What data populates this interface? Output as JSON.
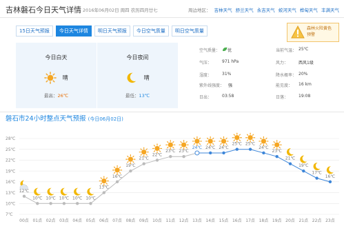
{
  "header": {
    "title": "吉林磐石今日天气详情",
    "date": "2016年06月02日   周四   农历四月廿七",
    "nearby_label": "周边地区：",
    "nearby": [
      "吉林天气",
      "舒兰天气",
      "永吉天气",
      "蛟河天气",
      "桦甸天气",
      "丰满天气"
    ]
  },
  "tabs": [
    "15日天气预报",
    "今日天气详情",
    "明日天气预报",
    "今日空气质量",
    "明日空气质量"
  ],
  "active_tab": 1,
  "alert": {
    "line1": "森林火险黄色",
    "line2": "预警"
  },
  "day": {
    "title": "今日白天",
    "weather": "晴",
    "temp_label": "最高：",
    "temp": "26℃",
    "icon": "sun-icon"
  },
  "night": {
    "title": "今日夜间",
    "weather": "晴",
    "temp_label": "最低：",
    "temp": "13℃",
    "icon": "moon-icon"
  },
  "details": [
    {
      "k1": "空气质量：",
      "v1": "优",
      "k2": "当前气温：",
      "v2": "25℃"
    },
    {
      "k1": "气压：",
      "v1": "971 hPa",
      "k2": "风力：",
      "v2": "西风1级"
    },
    {
      "k1": "湿度：",
      "v1": "31%",
      "k2": "降水概率：",
      "v2": "20%"
    },
    {
      "k1": "紫外线强度：",
      "v1": "强",
      "k2": "能见度：",
      "v2": "16 km"
    },
    {
      "k1": "日出：",
      "v1": "03:58",
      "k2": "日落：",
      "v2": "19:08"
    }
  ],
  "chart_title": "磐石市24小时整点天气预报",
  "chart_subtitle": "(今日06月02日)",
  "chart_data": {
    "type": "line",
    "x": [
      "00点",
      "01点",
      "02点",
      "03点",
      "04点",
      "05点",
      "06点",
      "07点",
      "08点",
      "09点",
      "10点",
      "11点",
      "12点",
      "13点",
      "14点",
      "15点",
      "16点",
      "17点",
      "18点",
      "19点",
      "20点",
      "21点",
      "22点",
      "23点"
    ],
    "y": [
      12,
      10,
      10,
      10,
      10,
      10,
      13,
      16,
      19,
      21,
      22,
      23,
      23,
      24,
      24,
      24,
      25,
      25,
      24,
      23,
      21,
      19,
      17,
      16
    ],
    "labels": [
      "12℃",
      "10℃",
      "10℃",
      "10℃",
      "10℃",
      "10℃",
      "13℃",
      "16℃",
      "19℃",
      "21℃",
      "22℃",
      "23℃",
      "23℃",
      "24℃",
      "24℃",
      "24℃",
      "25℃",
      "25℃",
      "24℃",
      "23℃",
      "21℃",
      "19℃",
      "17℃",
      "16℃"
    ],
    "y_ticks": [
      "28℃",
      "25℃",
      "22℃",
      "19℃",
      "16℃",
      "13℃",
      "10℃",
      "7℃"
    ],
    "ylim": [
      7,
      28
    ],
    "icons": [
      "cloud-moon",
      "moon",
      "moon",
      "moon",
      "moon",
      "moon",
      "sun",
      "sun",
      "sun",
      "sun",
      "sun",
      "sun",
      "sun",
      "sun",
      "sun",
      "sun",
      "sun",
      "sun",
      "sun",
      "sun",
      "moon",
      "moon",
      "moon",
      "moon"
    ],
    "past_count": 14,
    "current_index": 13,
    "colors": {
      "past": "#bbbbbb",
      "future": "#3d86d9",
      "current_fill": "#ffffff"
    },
    "grid": true
  },
  "colors": {
    "accent": "#1d86e0",
    "sun": "#f5a623",
    "moon": "#f2b705",
    "alert_bg": "#fff8e4"
  }
}
